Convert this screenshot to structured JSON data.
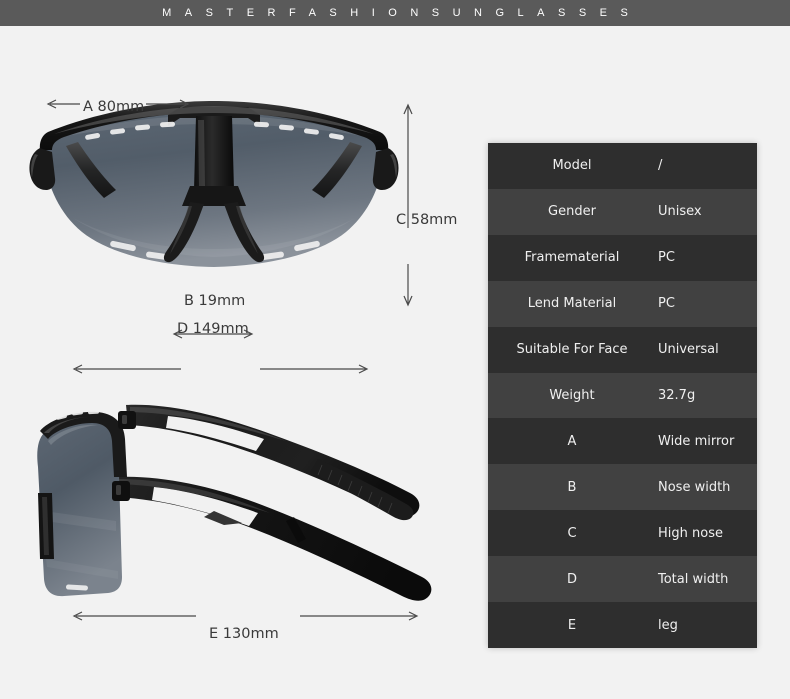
{
  "banner": {
    "brand_text": "MASTERFASHIONSUNGLASSES"
  },
  "diagram": {
    "front_view_name": "sunglasses-front-view",
    "side_view_name": "sunglasses-side-view",
    "dimensions": {
      "a": "A 80mm",
      "b": "B 19mm",
      "c": "C 58mm",
      "d": "D 149mm",
      "e": "E 130mm"
    }
  },
  "spec_table": {
    "rows": [
      {
        "key": "Model",
        "value": "/"
      },
      {
        "key": "Gender",
        "value": "Unisex"
      },
      {
        "key": "Framematerial",
        "value": "PC"
      },
      {
        "key": "Lend Material",
        "value": "PC"
      },
      {
        "key": "Suitable For Face",
        "value": "Universal"
      },
      {
        "key": "Weight",
        "value": "32.7g"
      },
      {
        "key": "A",
        "value": "Wide mirror"
      },
      {
        "key": "B",
        "value": "Nose width"
      },
      {
        "key": "C",
        "value": "High nose"
      },
      {
        "key": "D",
        "value": "Total width"
      },
      {
        "key": "E",
        "value": "leg"
      }
    ]
  },
  "colors": {
    "background": "#f2f2f2",
    "banner": "#5a5a5a",
    "row_dark": "#2e2e2e",
    "row_light": "#414141",
    "frame": "#1c1c1c",
    "lens": "#4e5a66",
    "dimension_line": "#4a4a4a"
  }
}
